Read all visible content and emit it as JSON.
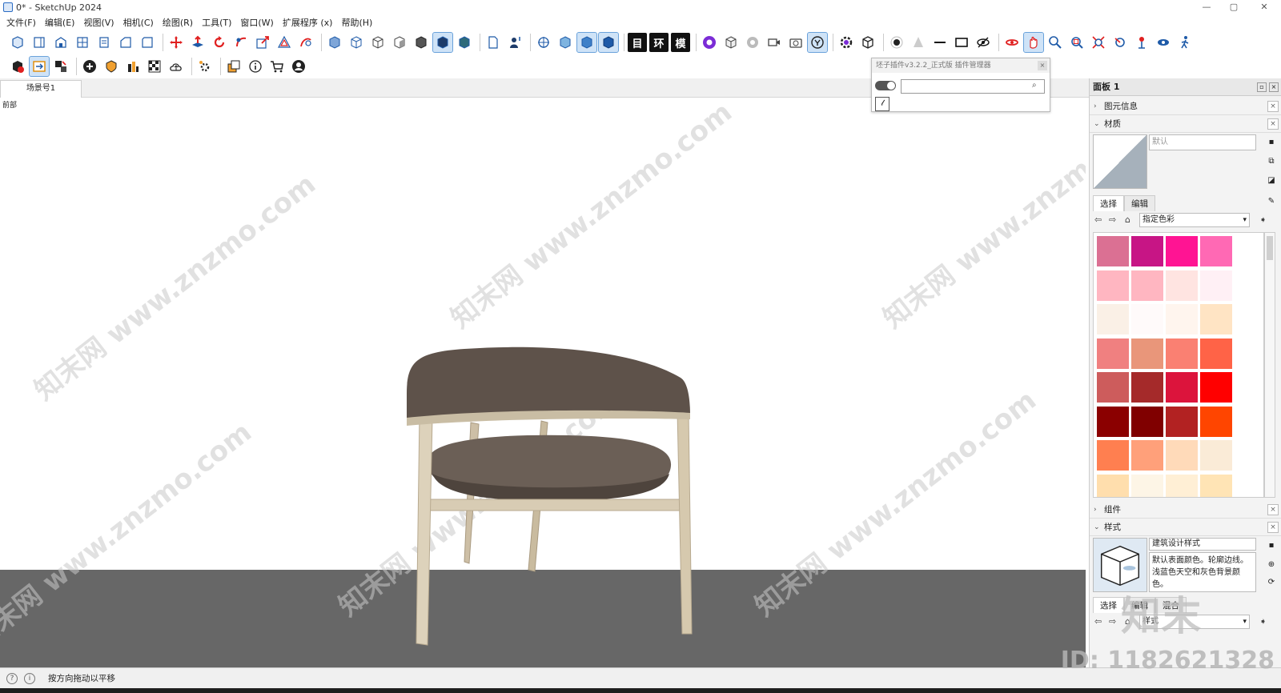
{
  "window": {
    "title": "0* - SketchUp 2024",
    "controls": [
      "—",
      "▢",
      "✕"
    ]
  },
  "menu": [
    "文件(F)",
    "编辑(E)",
    "视图(V)",
    "相机(C)",
    "绘图(R)",
    "工具(T)",
    "窗口(W)",
    "扩展程序 (x)",
    "帮助(H)"
  ],
  "toolbar": {
    "row1_text_buttons": [
      "目",
      "环",
      "模"
    ]
  },
  "scene": {
    "tab_label": "场景号1",
    "viewport_label": "前部"
  },
  "plugin_popup": {
    "title": "坯子插件v3.2.2_正式版 插件管理器",
    "close_label": "×",
    "search_value": "",
    "button_label": "𝓁"
  },
  "tray": {
    "title": "面板 1",
    "sections": {
      "entity_info": "图元信息",
      "materials": "材质",
      "components": "组件",
      "styles": "样式"
    },
    "materials": {
      "name_placeholder": "默认",
      "tabs": [
        "选择",
        "编辑"
      ],
      "collection": "指定色彩",
      "swatches": [
        [
          "#db7093",
          "#c71585",
          "#ff1493",
          "#ff69b4"
        ],
        [
          "#ffb6c1",
          "#ffb6c1",
          "#ffe4e1",
          "#fff0f5"
        ],
        [
          "#faf0e6",
          "#fffafa",
          "#fff5ee",
          "#ffe4c4"
        ],
        [
          "#f08080",
          "#e9967a",
          "#fa8072",
          "#ff6347"
        ],
        [
          "#cd5c5c",
          "#a52a2a",
          "#dc143c",
          "#ff0000"
        ],
        [
          "#8b0000",
          "#800000",
          "#b22222",
          "#ff4500"
        ],
        [
          "#ff7f50",
          "#ffa07a",
          "#ffdab9",
          "#faebd7"
        ],
        [
          "#ffdead",
          "#fdf5e6",
          "#ffefd5",
          "#ffe4b5"
        ]
      ]
    },
    "styles": {
      "name": "建筑设计样式",
      "description": "默认表面颜色。轮廓边线。浅蓝色天空和灰色背景颜色。",
      "tabs": [
        "选择",
        "编辑",
        "混合"
      ],
      "collection": "样式"
    }
  },
  "status": {
    "message": "按方向拖动以平移"
  },
  "watermark": {
    "text": "知末网 www.znzmo.com",
    "id": "ID: 1182621328",
    "brand": "知末"
  }
}
